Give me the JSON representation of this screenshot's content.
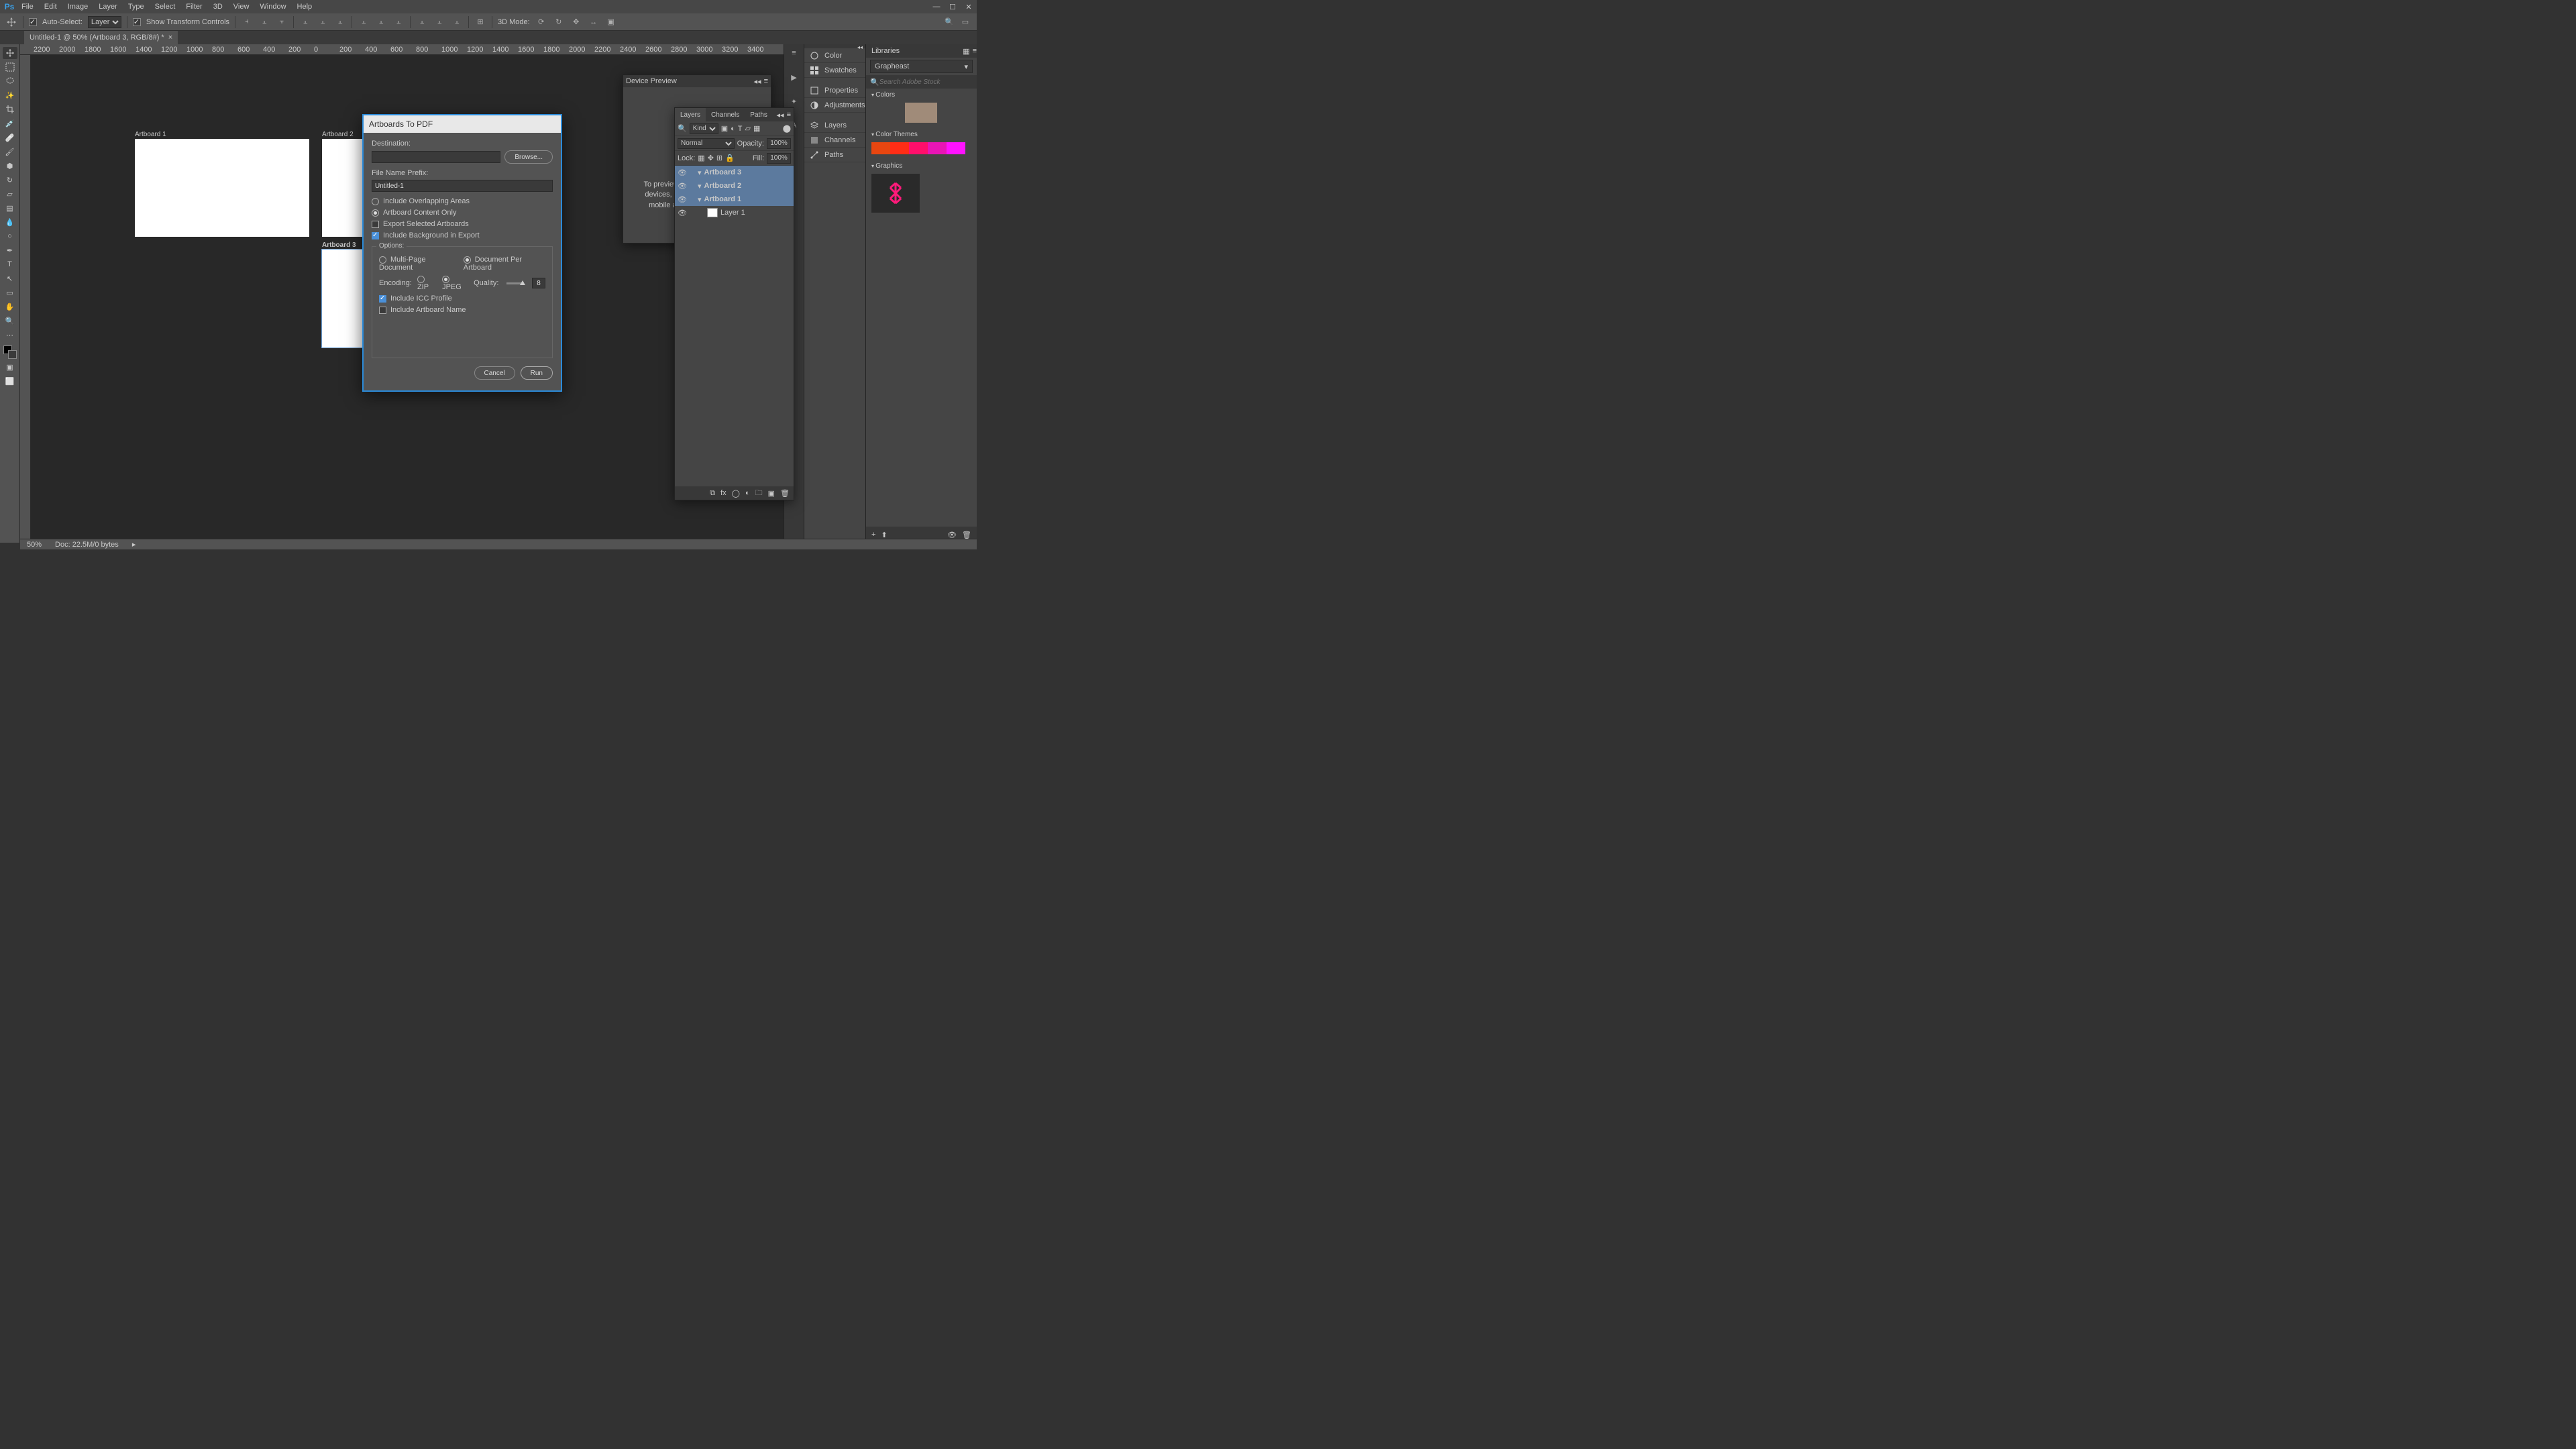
{
  "app": {
    "logo": "Ps"
  },
  "menus": [
    "File",
    "Edit",
    "Image",
    "Layer",
    "Type",
    "Select",
    "Filter",
    "3D",
    "View",
    "Window",
    "Help"
  ],
  "options": {
    "auto_select": "Auto-Select:",
    "auto_select_value": "Layer",
    "show_transform": "Show Transform Controls",
    "mode3d": "3D Mode:"
  },
  "doc": {
    "tab": "Untitled-1 @ 50% (Artboard 3, RGB/8#) *"
  },
  "ruler_marks": [
    "2200",
    "2000",
    "1800",
    "1600",
    "1400",
    "1200",
    "1000",
    "800",
    "600",
    "400",
    "200",
    "0",
    "200",
    "400",
    "600",
    "800",
    "1000",
    "1200",
    "1400",
    "1600",
    "1800",
    "2000",
    "2200",
    "2400",
    "2600",
    "2800",
    "3000",
    "3200",
    "3400"
  ],
  "artboards": {
    "a1": "Artboard 1",
    "a2": "Artboard 2",
    "a3": "Artboard 3"
  },
  "device_preview": {
    "title": "Device Preview",
    "body": "To preview, connect one or more devices, launch the Preview CC mobile app, and tap Connect."
  },
  "layers_panel": {
    "tabs": [
      "Layers",
      "Channels",
      "Paths"
    ],
    "kind": "Kind",
    "blend": "Normal",
    "opacity_lbl": "Opacity:",
    "opacity_val": "100%",
    "lock_lbl": "Lock:",
    "fill_lbl": "Fill:",
    "fill_val": "100%",
    "items": [
      {
        "label": "Artboard 3",
        "sel": true,
        "thumb": false
      },
      {
        "label": "Artboard 2",
        "sel": true,
        "thumb": false
      },
      {
        "label": "Artboard 1",
        "sel": true,
        "thumb": false
      },
      {
        "label": "Layer 1",
        "sel": false,
        "thumb": true
      }
    ]
  },
  "panel_names": [
    "Color",
    "Swatches",
    "Properties",
    "Adjustments",
    "Layers",
    "Channels",
    "Paths"
  ],
  "libraries": {
    "title": "Libraries",
    "dropdown": "Grapheast",
    "search_ph": "Search Adobe Stock",
    "sections": {
      "colors": "Colors",
      "themes": "Color Themes",
      "graphics": "Graphics"
    },
    "colors": [
      "#c459a7",
      "#a08b79"
    ],
    "theme": [
      "#e84610",
      "#ff2d16",
      "#ff0f6b",
      "#e815b5",
      "#ff12ff"
    ]
  },
  "status": {
    "zoom": "50%",
    "doc": "Doc: 22.5M/0 bytes"
  },
  "dialog": {
    "title": "Artboards To PDF",
    "destination": "Destination:",
    "browse": "Browse...",
    "prefix_label": "File Name Prefix:",
    "prefix_value": "Untitled-1",
    "opt_overlap": "Include Overlapping Areas",
    "opt_content": "Artboard Content Only",
    "opt_selected": "Export Selected Artboards",
    "opt_bg": "Include Background in Export",
    "options_legend": "Options:",
    "multi": "Multi-Page Document",
    "per": "Document Per Artboard",
    "encoding": "Encoding:",
    "zip": "ZIP",
    "jpeg": "JPEG",
    "quality": "Quality:",
    "quality_val": "8",
    "icc": "Include ICC Profile",
    "incl_name": "Include Artboard Name",
    "cancel": "Cancel",
    "run": "Run"
  }
}
